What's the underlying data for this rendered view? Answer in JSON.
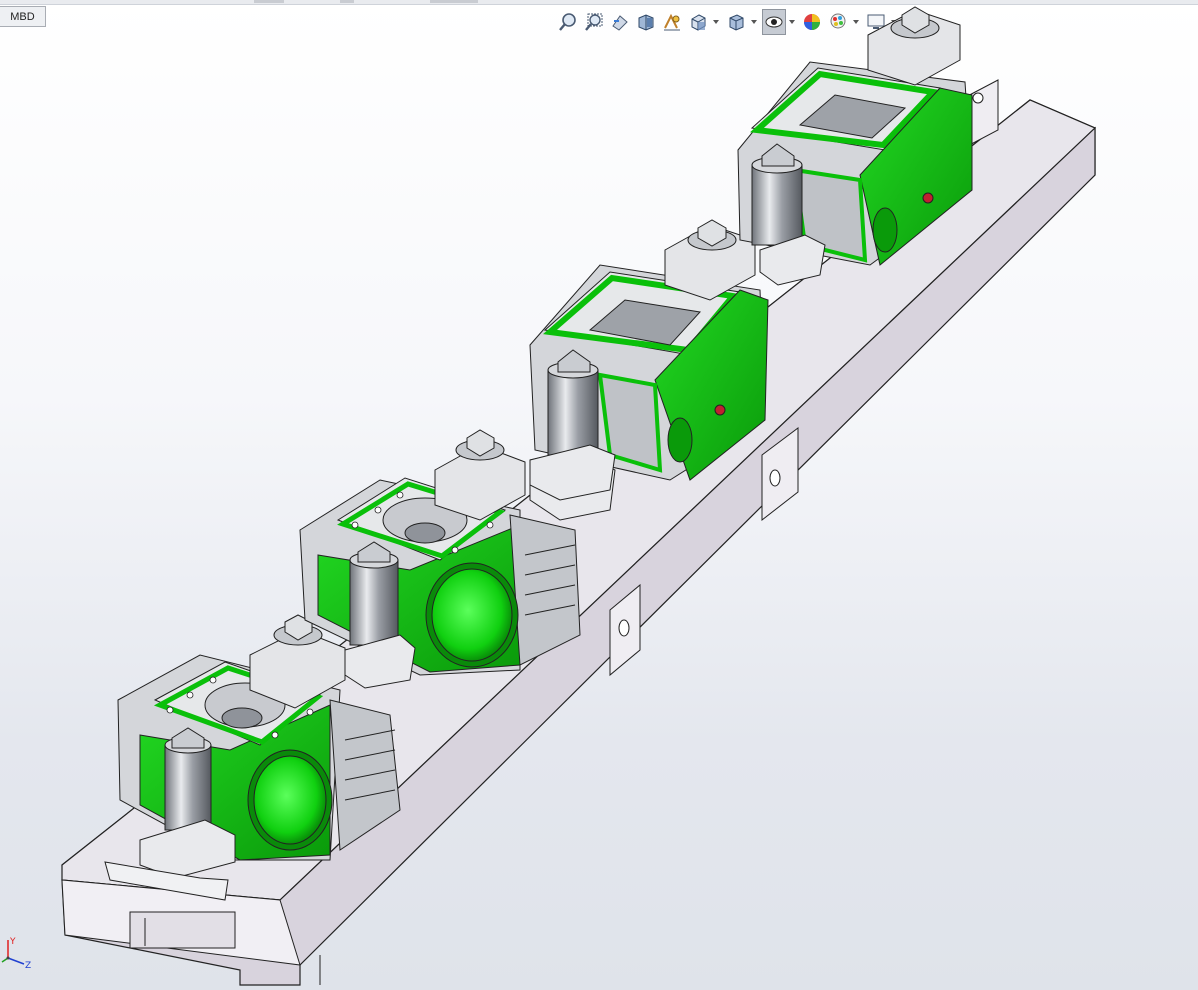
{
  "tabs": {
    "mbd_label": "MBD"
  },
  "heads_up_toolbar": [
    {
      "name": "zoom-to-fit-icon",
      "has_dropdown": false
    },
    {
      "name": "zoom-to-area-icon",
      "has_dropdown": false
    },
    {
      "name": "previous-view-icon",
      "has_dropdown": false
    },
    {
      "name": "section-view-icon",
      "has_dropdown": false
    },
    {
      "name": "dynamic-annotation-icon",
      "has_dropdown": false
    },
    {
      "name": "view-orientation-icon",
      "has_dropdown": true
    },
    {
      "name": "display-style-icon",
      "has_dropdown": true
    },
    {
      "name": "hide-show-items-icon",
      "has_dropdown": true,
      "active": true
    },
    {
      "name": "edit-appearance-icon",
      "has_dropdown": false
    },
    {
      "name": "apply-scene-icon",
      "has_dropdown": true
    },
    {
      "name": "view-settings-icon",
      "has_dropdown": true
    }
  ],
  "triad": {
    "y_label": "Y",
    "z_label": "Z",
    "x_color": "#e02020",
    "y_color": "#20a020",
    "z_color": "#2040d0"
  },
  "colors": {
    "part_green": "#00c800",
    "part_green_dark": "#0a8a0a",
    "base_plate": "#e6e3ea",
    "base_plate_side": "#cbc6d1",
    "steel": "#b9bcc2"
  }
}
